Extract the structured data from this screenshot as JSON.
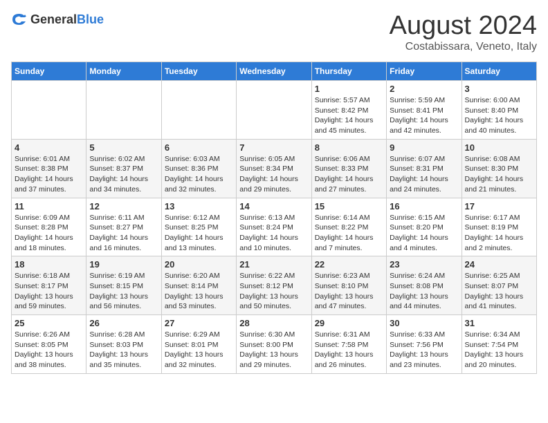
{
  "logo": {
    "general": "General",
    "blue": "Blue"
  },
  "title": "August 2024",
  "subtitle": "Costabissara, Veneto, Italy",
  "headers": [
    "Sunday",
    "Monday",
    "Tuesday",
    "Wednesday",
    "Thursday",
    "Friday",
    "Saturday"
  ],
  "weeks": [
    [
      {
        "day": "",
        "info": ""
      },
      {
        "day": "",
        "info": ""
      },
      {
        "day": "",
        "info": ""
      },
      {
        "day": "",
        "info": ""
      },
      {
        "day": "1",
        "info": "Sunrise: 5:57 AM\nSunset: 8:42 PM\nDaylight: 14 hours\nand 45 minutes."
      },
      {
        "day": "2",
        "info": "Sunrise: 5:59 AM\nSunset: 8:41 PM\nDaylight: 14 hours\nand 42 minutes."
      },
      {
        "day": "3",
        "info": "Sunrise: 6:00 AM\nSunset: 8:40 PM\nDaylight: 14 hours\nand 40 minutes."
      }
    ],
    [
      {
        "day": "4",
        "info": "Sunrise: 6:01 AM\nSunset: 8:38 PM\nDaylight: 14 hours\nand 37 minutes."
      },
      {
        "day": "5",
        "info": "Sunrise: 6:02 AM\nSunset: 8:37 PM\nDaylight: 14 hours\nand 34 minutes."
      },
      {
        "day": "6",
        "info": "Sunrise: 6:03 AM\nSunset: 8:36 PM\nDaylight: 14 hours\nand 32 minutes."
      },
      {
        "day": "7",
        "info": "Sunrise: 6:05 AM\nSunset: 8:34 PM\nDaylight: 14 hours\nand 29 minutes."
      },
      {
        "day": "8",
        "info": "Sunrise: 6:06 AM\nSunset: 8:33 PM\nDaylight: 14 hours\nand 27 minutes."
      },
      {
        "day": "9",
        "info": "Sunrise: 6:07 AM\nSunset: 8:31 PM\nDaylight: 14 hours\nand 24 minutes."
      },
      {
        "day": "10",
        "info": "Sunrise: 6:08 AM\nSunset: 8:30 PM\nDaylight: 14 hours\nand 21 minutes."
      }
    ],
    [
      {
        "day": "11",
        "info": "Sunrise: 6:09 AM\nSunset: 8:28 PM\nDaylight: 14 hours\nand 18 minutes."
      },
      {
        "day": "12",
        "info": "Sunrise: 6:11 AM\nSunset: 8:27 PM\nDaylight: 14 hours\nand 16 minutes."
      },
      {
        "day": "13",
        "info": "Sunrise: 6:12 AM\nSunset: 8:25 PM\nDaylight: 14 hours\nand 13 minutes."
      },
      {
        "day": "14",
        "info": "Sunrise: 6:13 AM\nSunset: 8:24 PM\nDaylight: 14 hours\nand 10 minutes."
      },
      {
        "day": "15",
        "info": "Sunrise: 6:14 AM\nSunset: 8:22 PM\nDaylight: 14 hours\nand 7 minutes."
      },
      {
        "day": "16",
        "info": "Sunrise: 6:15 AM\nSunset: 8:20 PM\nDaylight: 14 hours\nand 4 minutes."
      },
      {
        "day": "17",
        "info": "Sunrise: 6:17 AM\nSunset: 8:19 PM\nDaylight: 14 hours\nand 2 minutes."
      }
    ],
    [
      {
        "day": "18",
        "info": "Sunrise: 6:18 AM\nSunset: 8:17 PM\nDaylight: 13 hours\nand 59 minutes."
      },
      {
        "day": "19",
        "info": "Sunrise: 6:19 AM\nSunset: 8:15 PM\nDaylight: 13 hours\nand 56 minutes."
      },
      {
        "day": "20",
        "info": "Sunrise: 6:20 AM\nSunset: 8:14 PM\nDaylight: 13 hours\nand 53 minutes."
      },
      {
        "day": "21",
        "info": "Sunrise: 6:22 AM\nSunset: 8:12 PM\nDaylight: 13 hours\nand 50 minutes."
      },
      {
        "day": "22",
        "info": "Sunrise: 6:23 AM\nSunset: 8:10 PM\nDaylight: 13 hours\nand 47 minutes."
      },
      {
        "day": "23",
        "info": "Sunrise: 6:24 AM\nSunset: 8:08 PM\nDaylight: 13 hours\nand 44 minutes."
      },
      {
        "day": "24",
        "info": "Sunrise: 6:25 AM\nSunset: 8:07 PM\nDaylight: 13 hours\nand 41 minutes."
      }
    ],
    [
      {
        "day": "25",
        "info": "Sunrise: 6:26 AM\nSunset: 8:05 PM\nDaylight: 13 hours\nand 38 minutes."
      },
      {
        "day": "26",
        "info": "Sunrise: 6:28 AM\nSunset: 8:03 PM\nDaylight: 13 hours\nand 35 minutes."
      },
      {
        "day": "27",
        "info": "Sunrise: 6:29 AM\nSunset: 8:01 PM\nDaylight: 13 hours\nand 32 minutes."
      },
      {
        "day": "28",
        "info": "Sunrise: 6:30 AM\nSunset: 8:00 PM\nDaylight: 13 hours\nand 29 minutes."
      },
      {
        "day": "29",
        "info": "Sunrise: 6:31 AM\nSunset: 7:58 PM\nDaylight: 13 hours\nand 26 minutes."
      },
      {
        "day": "30",
        "info": "Sunrise: 6:33 AM\nSunset: 7:56 PM\nDaylight: 13 hours\nand 23 minutes."
      },
      {
        "day": "31",
        "info": "Sunrise: 6:34 AM\nSunset: 7:54 PM\nDaylight: 13 hours\nand 20 minutes."
      }
    ]
  ]
}
